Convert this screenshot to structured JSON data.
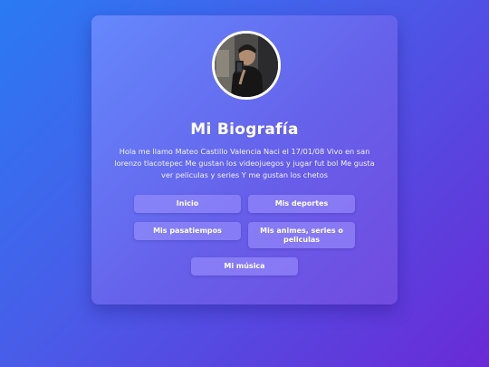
{
  "profile": {
    "title": "Mi Biografía",
    "bio": "Hola me llamo Mateo Castillo Valencia Naci el 17/01/08 Vivo en san lorenzo tlacotepec Me gustan los videojuegos y jugar fut bol Me gusta ver peliculas y series Y me gustan los chetos"
  },
  "nav": {
    "inicio": "Inicio",
    "deportes": "Mis deportes",
    "pasatiempos": "Mis pasatiempos",
    "animes": "Mis animes, series o peliculas",
    "musica": "Mi música"
  },
  "colors": {
    "background_start": "#2a7af3",
    "background_end": "#6a2ad6",
    "button": "#a096ff"
  },
  "icons": {
    "avatar": "profile-photo"
  }
}
